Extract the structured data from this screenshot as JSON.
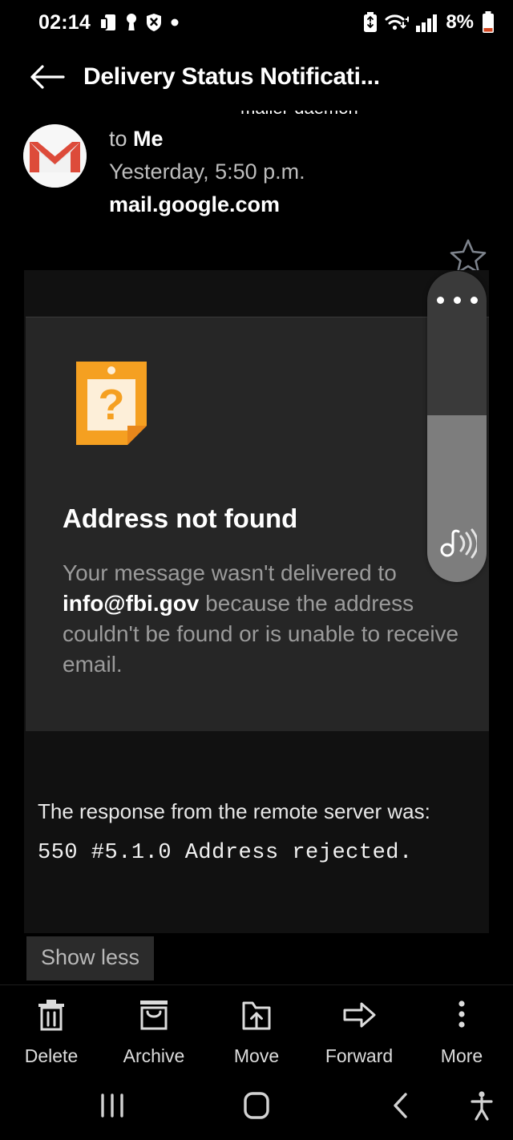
{
  "status_bar": {
    "time": "02:14",
    "left_icons": [
      "dual-sim-icon",
      "key-icon",
      "shield-x-icon",
      "dot-icon"
    ],
    "right_icons": [
      "battery-saver-icon",
      "wifi-icon",
      "signal-bars-icon"
    ],
    "battery_percent": "8%",
    "battery_color": "#d4451f"
  },
  "header": {
    "back_label": "back-arrow",
    "title": "Delivery Status Notificati..."
  },
  "sender": {
    "ghost_text": "mailer-daemon",
    "avatar": "gmail-logo",
    "to_prefix": "to ",
    "to_recipient": "Me",
    "date": "Yesterday, 5:50 p.m.",
    "domain": "mail.google.com",
    "star_state": "unstarred"
  },
  "message": {
    "icon": "orange-document-question-icon",
    "title": "Address not found",
    "body_part1": "Your message wasn't delivered to ",
    "body_email": "info@fbi.gov",
    "body_part2": " because the address couldn't be found or is unable to receive email.",
    "response_label": "The response from the remote server was:",
    "response_code": "550 #5.1.0 Address rejected.",
    "show_less_label": "Show less"
  },
  "volume_widget": {
    "menu_icon": "three-dots-icon",
    "sound_icon": "music-note-waves-icon",
    "level_percent": 54
  },
  "actions": [
    {
      "label": "Delete",
      "icon": "trash-icon"
    },
    {
      "label": "Archive",
      "icon": "archive-box-icon"
    },
    {
      "label": "Move",
      "icon": "folder-up-arrow-icon"
    },
    {
      "label": "Forward",
      "icon": "forward-arrow-icon"
    },
    {
      "label": "More",
      "icon": "vertical-dots-icon"
    }
  ],
  "navbar": {
    "recents": "recents-icon",
    "home": "home-icon",
    "back": "back-chevron-icon",
    "accessibility": "accessibility-icon"
  },
  "colors": {
    "background": "#000000",
    "card_outer": "#111111",
    "card_inner": "#262626",
    "accent_orange": "#f5a021",
    "gmail_red": "#dd4b3a"
  }
}
